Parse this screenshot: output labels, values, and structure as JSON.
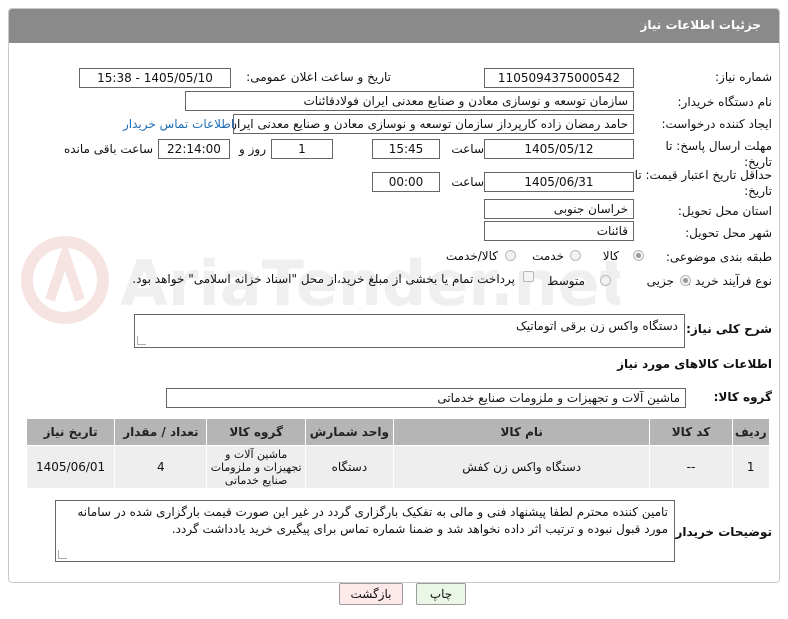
{
  "header": {
    "title": "جزئیات اطلاعات نیاز"
  },
  "labels": {
    "need_number": "شماره نیاز:",
    "announce_datetime": "تاریخ و ساعت اعلان عمومی:",
    "buyer_org": "نام دستگاه خریدار:",
    "requester": "ایجاد کننده درخواست:",
    "reply_deadline": "مهلت ارسال پاسخ: تا تاریخ:",
    "time_word": "ساعت",
    "day_and": "روز و",
    "remaining": "ساعت باقی مانده",
    "price_validity": "حداقل تاریخ اعتبار قیمت: تا تاریخ:",
    "delivery_province": "استان محل تحویل:",
    "delivery_city": "شهر محل تحویل:",
    "category": "طبقه بندی موضوعی:",
    "process_type": "نوع فرآیند خرید :",
    "general_desc": "شرح کلی نیاز:",
    "goods_info": "اطلاعات کالاهای مورد نیاز",
    "goods_group": "گروه کالا:",
    "buyer_notes": "توضیحات خریدار:"
  },
  "values": {
    "need_number": "1105094375000542",
    "announce_datetime": "1405/05/10 - 15:38",
    "buyer_org": "سازمان توسعه و نوسازی معادن و صنایع معدنی ایران فولادقائنات",
    "requester": "حامد  رمضان زاده  کارپرداز  سازمان توسعه و نوسازی معادن و صنایع معدنی ایران",
    "contact_link": "اطلاعات تماس خریدار",
    "reply_date": "1405/05/12",
    "reply_time": "15:45",
    "days": "1",
    "remaining_time": "22:14:00",
    "price_date": "1405/06/31",
    "price_time": "00:00",
    "province": "خراسان جنوبی",
    "city": "قائنات",
    "general_desc": "دستگاه واکس زن برقی اتوماتیک",
    "goods_group": "ماشین آلات و تجهیزات و ملزومات صنایع خدماتی",
    "buyer_notes": "تامین کننده محترم لطفا پیشنهاد فنی و مالی به تفکیک بارگزاری گردد در غیر این صورت قیمت بارگزاری شده در سامانه مورد قبول نبوده و ترتیب اثر داده نخواهد شد و ضمنا شماره تماس برای پیگیری خرید یادداشت گردد."
  },
  "category_options": [
    {
      "label": "کالا",
      "selected": true
    },
    {
      "label": "خدمت",
      "selected": false
    },
    {
      "label": "کالا/خدمت",
      "selected": false
    }
  ],
  "process_options": [
    {
      "label": "جزیی",
      "selected": true
    },
    {
      "label": "متوسط",
      "selected": false
    }
  ],
  "payment_note": "پرداخت تمام یا بخشی از مبلغ خرید،از محل \"اسناد خزانه اسلامی\" خواهد بود.",
  "table": {
    "headers": [
      "ردیف",
      "کد کالا",
      "نام کالا",
      "واحد شمارش",
      "گروه کالا",
      "تعداد / مقدار",
      "تاریخ نیاز"
    ],
    "rows": [
      [
        "1",
        "--",
        "دستگاه واکس زن کفش",
        "دستگاه",
        "ماشین آلات و تجهیزات و ملزومات صنایع خدماتی",
        "4",
        "1405/06/01"
      ]
    ]
  },
  "buttons": {
    "print": "چاپ",
    "back": "بازگشت"
  },
  "watermark_text": "AriaTender.net"
}
